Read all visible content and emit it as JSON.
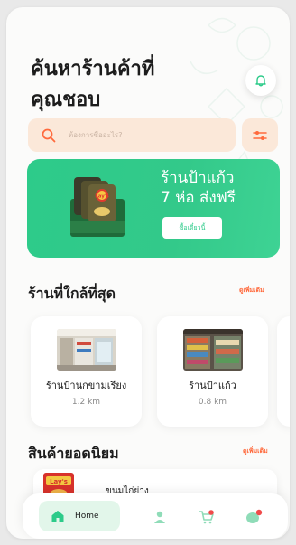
{
  "header": {
    "title_line1": "ค้นหาร้านค้าที่",
    "title_line2": "คุณชอบ",
    "notification_icon": "bell-icon"
  },
  "search": {
    "placeholder": "ต้องการซื้ออะไร?",
    "icon": "search-icon",
    "filter_icon": "filter-icon"
  },
  "banner": {
    "line1": "ร้านป้าแก้ว",
    "line2": "7 ห่อ ส่งฟรี",
    "button_label": "ซื้อเดี๋ยวนี้",
    "brand_text": "Lay's"
  },
  "nearby": {
    "title": "ร้านที่ใกล้ที่สุด",
    "see_more": "ดูเพิ่มเติม",
    "stores": [
      {
        "name": "ร้านป้านกขามเรียง",
        "distance": "1.2 km"
      },
      {
        "name": "ร้านป้าแก้ว",
        "distance": "0.8 km"
      }
    ]
  },
  "popular": {
    "title": "สินค้ายอดนิยม",
    "see_more": "ดูเพิ่มเติม",
    "products": [
      {
        "name": "ขนมไก่ย่าง",
        "brand_text": "Lay's"
      }
    ]
  },
  "nav": {
    "home_label": "Home",
    "items": [
      "home-icon",
      "profile-icon",
      "cart-icon",
      "chat-icon"
    ]
  },
  "colors": {
    "accent_green": "#2dcb8a",
    "search_bg": "#fbe8d9",
    "link_orange": "#ff6a3d",
    "badge_red": "#f04a4a"
  }
}
